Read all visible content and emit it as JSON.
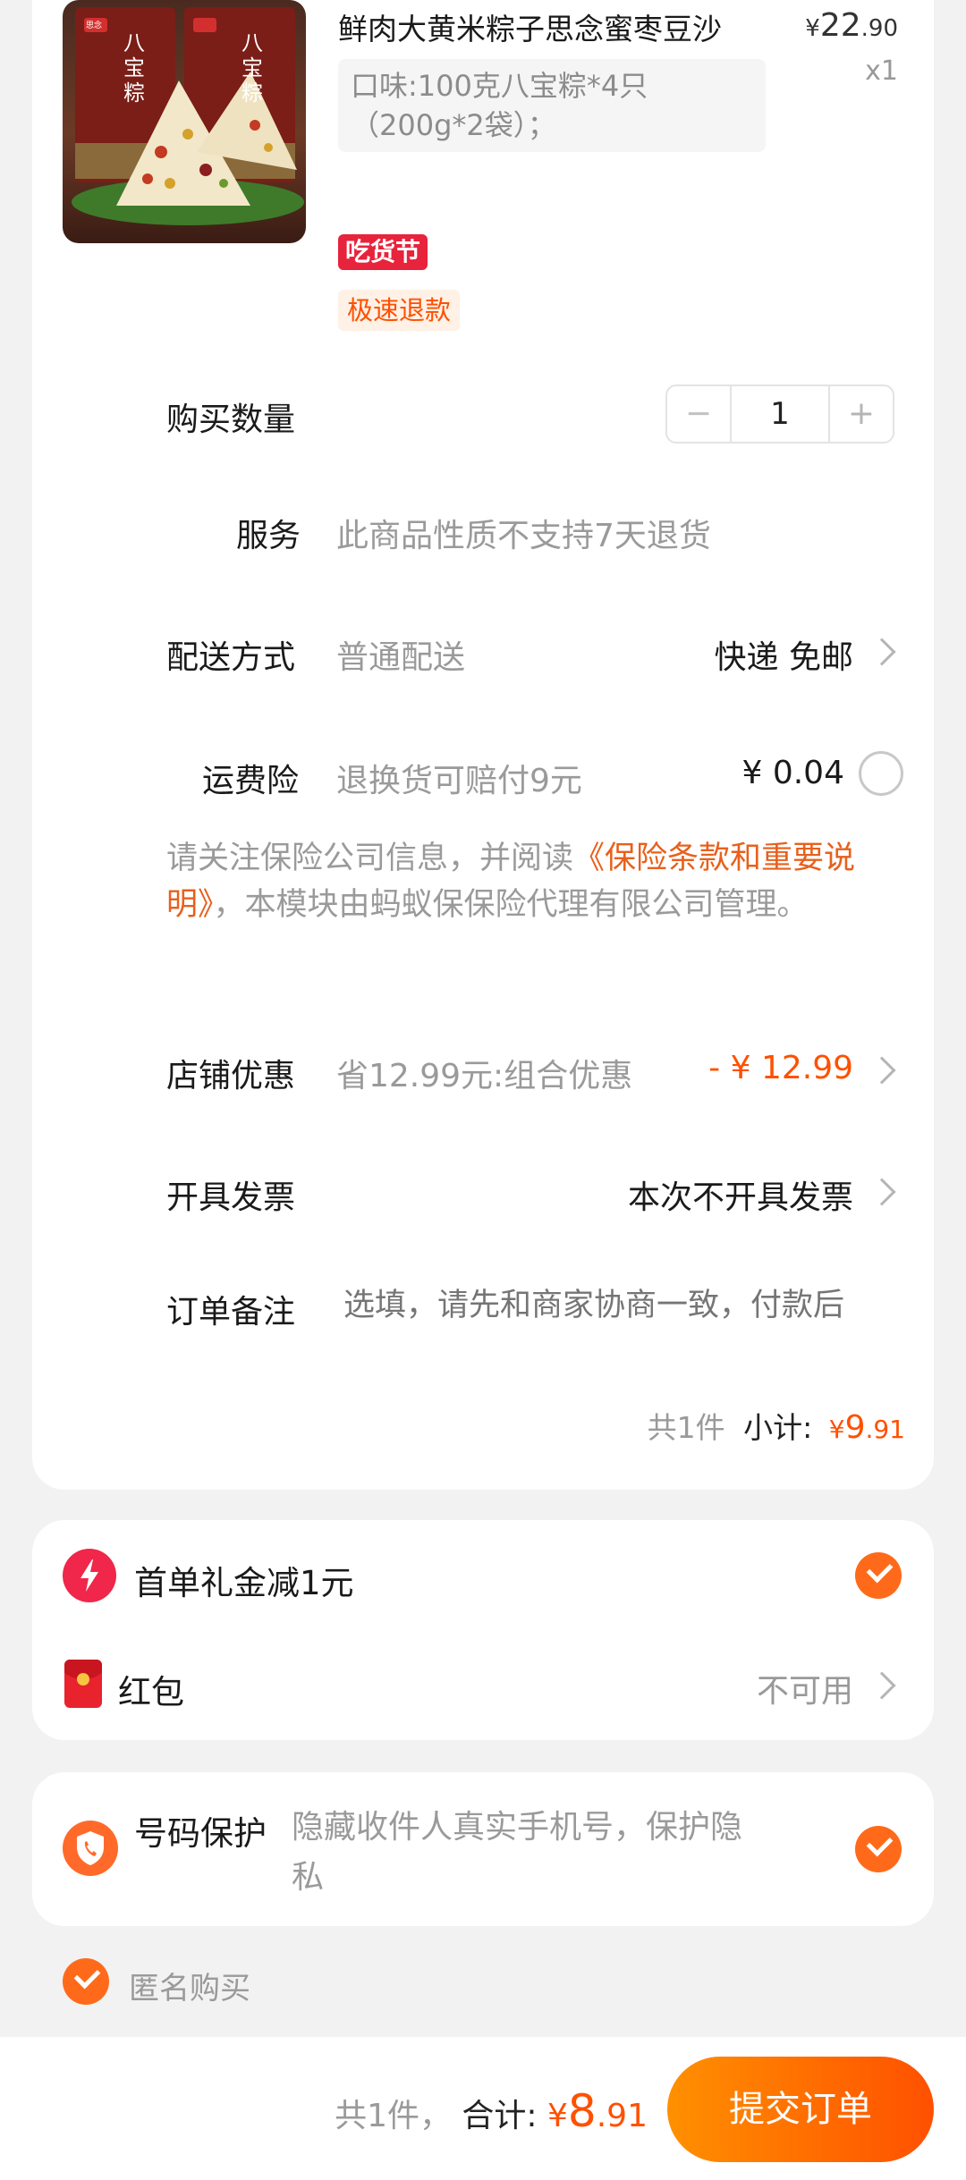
{
  "product": {
    "image_brand": "思念",
    "image_label": "八宝粽",
    "title": "鲜肉大黄米粽子思念蜜枣豆沙",
    "price_main": "22",
    "price_dec": ".90",
    "currency": "¥",
    "qty_label": "x1",
    "sku_line1": "口味:100克八宝粽*4只",
    "sku_line2": "（200g*2袋）；",
    "tag_festival": "吃货节",
    "tag_refund": "极速退款"
  },
  "order": {
    "quantity_label": "购买数量",
    "quantity_value": "1",
    "minus": "−",
    "plus": "+",
    "service_label": "服务",
    "service_value": "此商品性质不支持7天退货",
    "delivery_label": "配送方式",
    "delivery_value": "普通配送",
    "delivery_right": "快递 免邮",
    "insurance_label": "运费险",
    "insurance_value": "退换货可赔付9元",
    "insurance_price": "¥ 0.04",
    "notice_pre": "请关注保险公司信息，并阅读",
    "notice_link": "《保险条款和重要说明》",
    "notice_post": "，本模块由蚂蚁保保险代理有限公司管理。",
    "shop_discount_label": "店铺优惠",
    "shop_discount_value": "省12.99元:组合优惠",
    "shop_discount_amount": "- ¥ 12.99",
    "invoice_label": "开具发票",
    "invoice_value": "本次不开具发票",
    "remark_label": "订单备注",
    "remark_placeholder": "选填，请先和商家协商一致，付款后",
    "count_text": "共1件",
    "subtotal_label": "小计:",
    "subtotal_currency": "¥",
    "subtotal_main": "9",
    "subtotal_dec": ".91"
  },
  "benefits": {
    "first_order": "首单礼金减1元",
    "red_packet": "红包",
    "red_packet_status": "不可用"
  },
  "privacy": {
    "label": "号码保护",
    "desc_line1": "隐藏收件人真实手机号，保护隐",
    "desc_line2": "私"
  },
  "anonymous": {
    "label": "匿名购买"
  },
  "footer": {
    "count_text": "共1件，",
    "total_label": "合计:",
    "total_currency": "¥",
    "total_main": "8",
    "total_dec": ".91",
    "submit": "提交订单"
  },
  "colors": {
    "accent": "#ff5000",
    "submit_gradient_start": "#ff9000",
    "submit_gradient_end": "#ff5000",
    "festival_tag": "#e8233c"
  },
  "icons": {
    "first_order": "lightning-icon",
    "red_packet": "red-envelope-icon",
    "privacy": "phone-shield-icon"
  }
}
